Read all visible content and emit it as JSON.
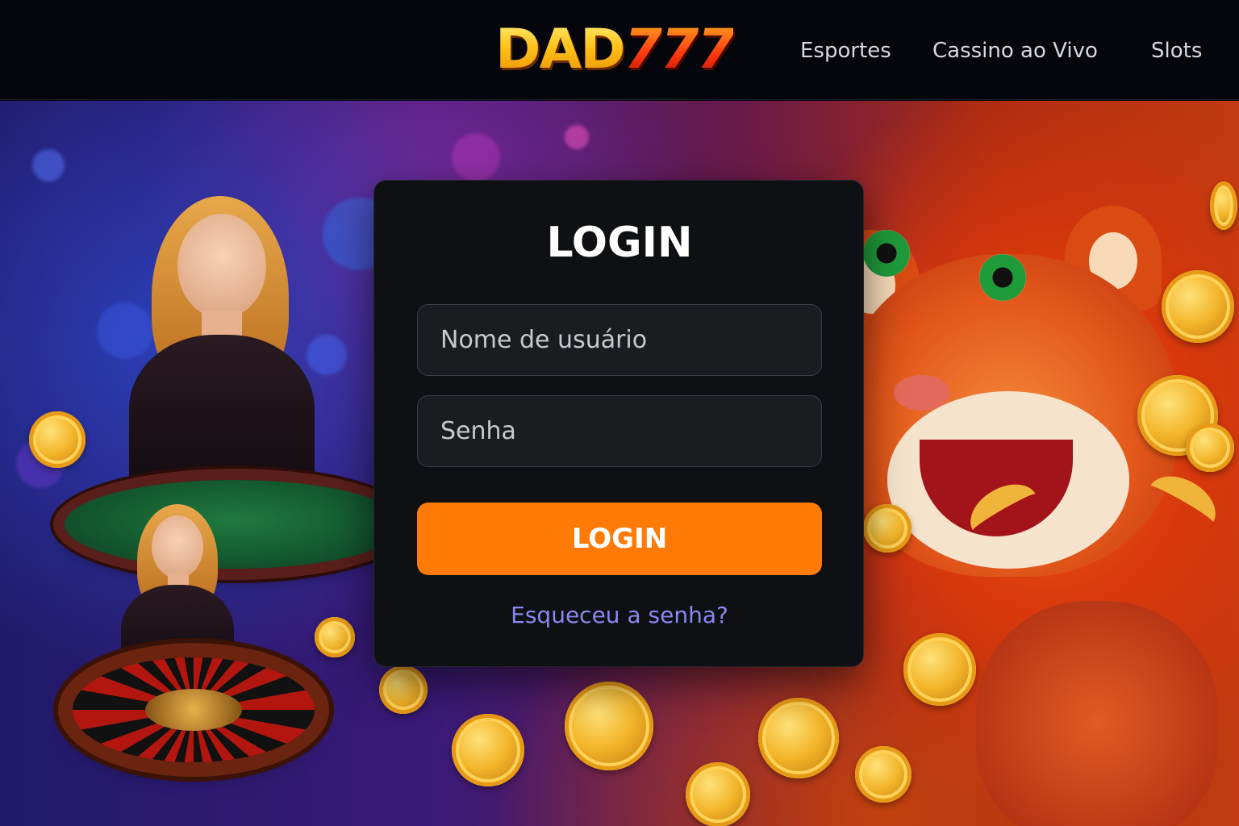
{
  "header": {
    "logo": {
      "main": "DAD",
      "accent": "777"
    },
    "nav": [
      "Esportes",
      "Cassino ao Vivo",
      "Slots"
    ]
  },
  "login": {
    "title": "LOGIN",
    "username_placeholder": "Nome de usuário",
    "password_placeholder": "Senha",
    "submit_label": "LOGIN",
    "forgot_label": "Esqueceu a senha?"
  },
  "hero": {
    "left_scene": "live-casino-dealers",
    "right_scene": "tiger-and-bull-slots"
  },
  "colors": {
    "header_bg": "#04060b",
    "card_bg": "#0e1014",
    "button": "#ff7a06",
    "link": "#8b88f0",
    "logo_gold": "#ffc21a",
    "logo_red": "#ff3a10"
  }
}
